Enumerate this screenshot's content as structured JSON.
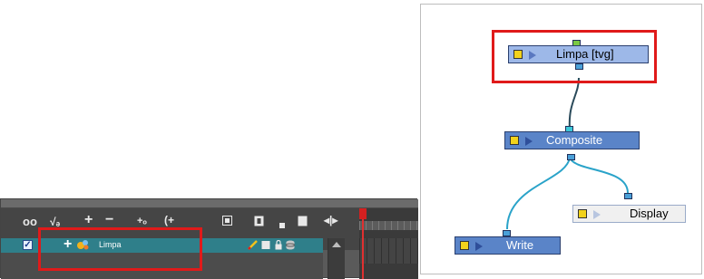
{
  "timeline": {
    "layer_name": "Limpa",
    "layer_enabled_mark": "✓",
    "toolbar_icons": [
      "onion-skin-icon",
      "onion-skin-frames-icon",
      "add-layer-icon",
      "remove-layer-icon",
      "add-peg-icon",
      "add-drawing-layer-icon",
      "layer-view-icon",
      "show-hide-icon",
      "lock-icon",
      "layer-color-icon",
      "expand-collapse-icon"
    ],
    "colors": {
      "layer_row": "#2f7f8a",
      "playhead": "#d42020"
    }
  },
  "node_view": {
    "nodes": [
      {
        "id": "limpa",
        "label": "Limpa [tvg]"
      },
      {
        "id": "composite",
        "label": "Composite"
      },
      {
        "id": "display",
        "label": "Display"
      },
      {
        "id": "write",
        "label": "Write"
      }
    ],
    "colors": {
      "node_default": "#5a84c8",
      "node_selected": "#9db8e8",
      "display_node": "#f0f0f0",
      "cable": "#2aa3c9",
      "highlight_box": "#e01a1a"
    }
  }
}
